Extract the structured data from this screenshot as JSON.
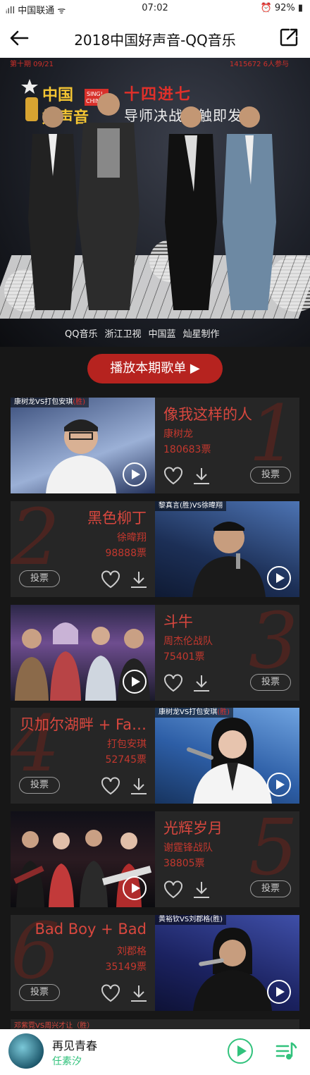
{
  "status": {
    "carrier": "ᵢıll 中国联通 ᯤ",
    "time": "07:02",
    "battery": "⏰ 92% ▮"
  },
  "header": {
    "title": "2018中国好声音-QQ音乐"
  },
  "banner": {
    "issue": "第十期 09/21",
    "participants": "1415672 6人参与",
    "logo_top": "中国",
    "logo_bottom": "好声音",
    "logo_badge": "SING! CHINA",
    "headline": "十四进七",
    "subline": "导师决战一触即发",
    "sponsors": [
      "QQ音乐",
      "浙江卫视",
      "中国蓝",
      "灿星制作"
    ]
  },
  "play_all": "播放本期歌单 ▶",
  "songs": [
    {
      "rank": "1",
      "title": "像我这样的人",
      "singer": "康树龙",
      "votes": "180683票",
      "tag_a": "康树龙VS打包安琪",
      "tag_b": "(胜)",
      "side": "left"
    },
    {
      "rank": "2",
      "title": "黑色柳丁",
      "singer": "徐暐翔",
      "votes": "98888票",
      "tag_a": "黎真言(胜)VS徐暐翔",
      "tag_b": "",
      "side": "right"
    },
    {
      "rank": "3",
      "title": "斗牛",
      "singer": "周杰伦战队",
      "votes": "75401票",
      "tag_a": "",
      "tag_b": "",
      "side": "left"
    },
    {
      "rank": "4",
      "title": "贝加尔湖畔 + Fa…",
      "singer": "打包安琪",
      "votes": "52745票",
      "tag_a": "康树龙VS打包安琪",
      "tag_b": "(胜)",
      "side": "right"
    },
    {
      "rank": "5",
      "title": "光辉岁月",
      "singer": "谢霆锋战队",
      "votes": "38805票",
      "tag_a": "",
      "tag_b": "",
      "side": "left"
    },
    {
      "rank": "6",
      "title": "Bad Boy + Bad",
      "singer": "刘郡格",
      "votes": "35149票",
      "tag_a": "黄裕钦VS刘郡格(胜)",
      "tag_b": "",
      "side": "right"
    }
  ],
  "vote_label": "投票",
  "peek_tag": "邓紫霓VS周兴才让（胜）",
  "now_playing": {
    "title": "再见青春",
    "artist": "任素汐"
  },
  "colors": {
    "accent": "#b6231f",
    "green": "#31c27c"
  }
}
